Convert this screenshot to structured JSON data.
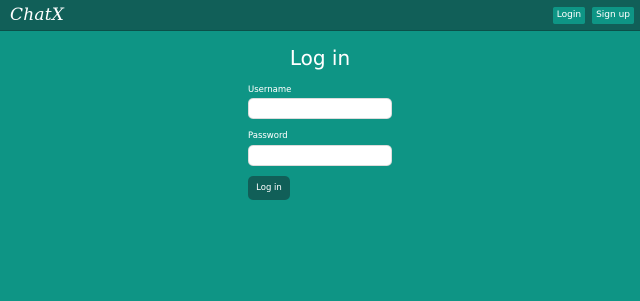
{
  "navbar": {
    "brand": "ChatX",
    "login_label": "Login",
    "signup_label": "Sign up"
  },
  "login": {
    "title": "Log in",
    "username_label": "Username",
    "username_value": "",
    "password_label": "Password",
    "password_value": "",
    "submit_label": "Log in"
  },
  "colors": {
    "background": "#0e9585",
    "navbar": "#115f58",
    "button": "#115f58"
  }
}
